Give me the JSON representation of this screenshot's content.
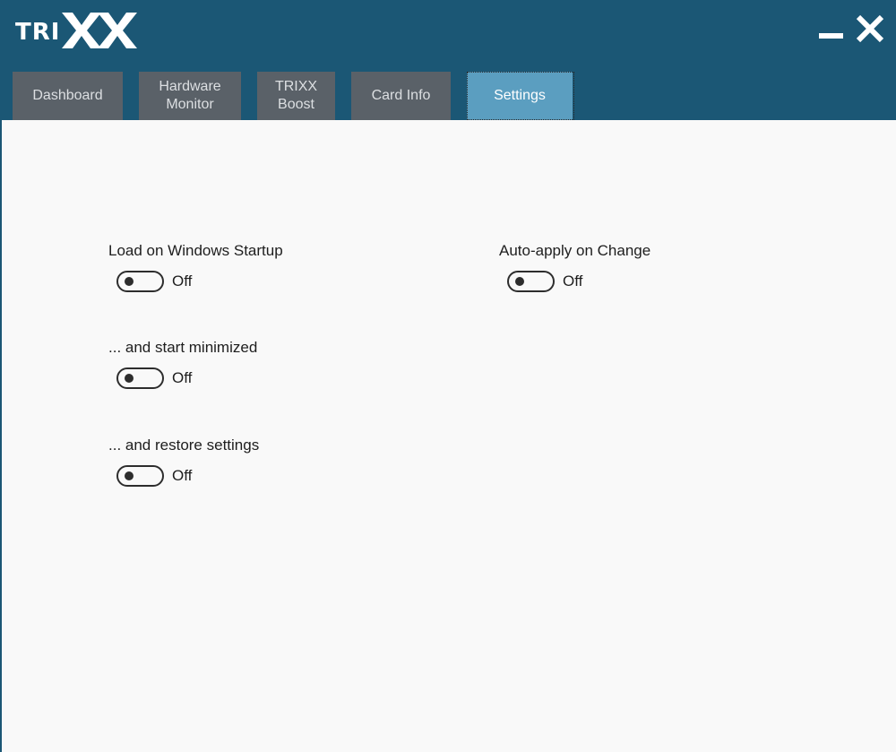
{
  "app": {
    "logo_prefix": "TRI",
    "logo_suffix": "XX",
    "accent_color": "#1b5775",
    "active_tab_color": "#5b9ec0"
  },
  "window_controls": {
    "minimize_icon": "minimize-icon",
    "close_icon": "close-icon"
  },
  "tabs": [
    {
      "label_line1": "Dashboard",
      "label_line2": ""
    },
    {
      "label_line1": "Hardware",
      "label_line2": "Monitor"
    },
    {
      "label_line1": "TRIXX",
      "label_line2": "Boost"
    },
    {
      "label_line1": "Card Info",
      "label_line2": ""
    },
    {
      "label_line1": "Settings",
      "label_line2": "",
      "active": true
    }
  ],
  "settings": {
    "load_on_startup": {
      "label": "Load on Windows Startup",
      "state": "Off"
    },
    "start_minimized": {
      "label": "... and start minimized",
      "state": "Off"
    },
    "restore_settings": {
      "label": "... and restore settings",
      "state": "Off"
    },
    "auto_apply": {
      "label": "Auto-apply on Change",
      "state": "Off"
    }
  }
}
